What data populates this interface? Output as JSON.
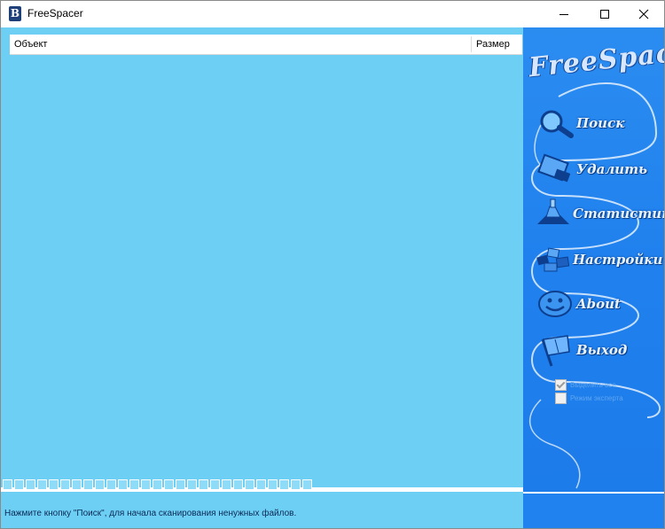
{
  "window": {
    "title": "FreeSpacer",
    "app_icon_letter": "B"
  },
  "list": {
    "columns": [
      {
        "label": "Объект"
      },
      {
        "label": "Размер"
      }
    ],
    "rows": []
  },
  "progress": {
    "cells": 27
  },
  "status": {
    "text": "Нажмите кнопку \"Поиск\", для начала сканирования ненужных файлов."
  },
  "panel": {
    "logo_text": "FreeSpacer",
    "menu": [
      {
        "label": "Поиск",
        "icon": "magnifier-icon"
      },
      {
        "label": "Удалить",
        "icon": "delete-icon"
      },
      {
        "label": "Статистика",
        "icon": "statistics-icon"
      },
      {
        "label": "Настройки",
        "icon": "settings-icon"
      },
      {
        "label": "About",
        "icon": "smiley-icon"
      },
      {
        "label": "Выход",
        "icon": "exit-flag-icon"
      }
    ],
    "checkboxes": [
      {
        "label": "Выделить все",
        "checked": true
      },
      {
        "label": "Режим эксперта",
        "checked": false
      }
    ]
  },
  "colors": {
    "list_bg": "#6ecff5",
    "panel_bg": "#1f80ee",
    "accent_white": "#ffffff"
  }
}
